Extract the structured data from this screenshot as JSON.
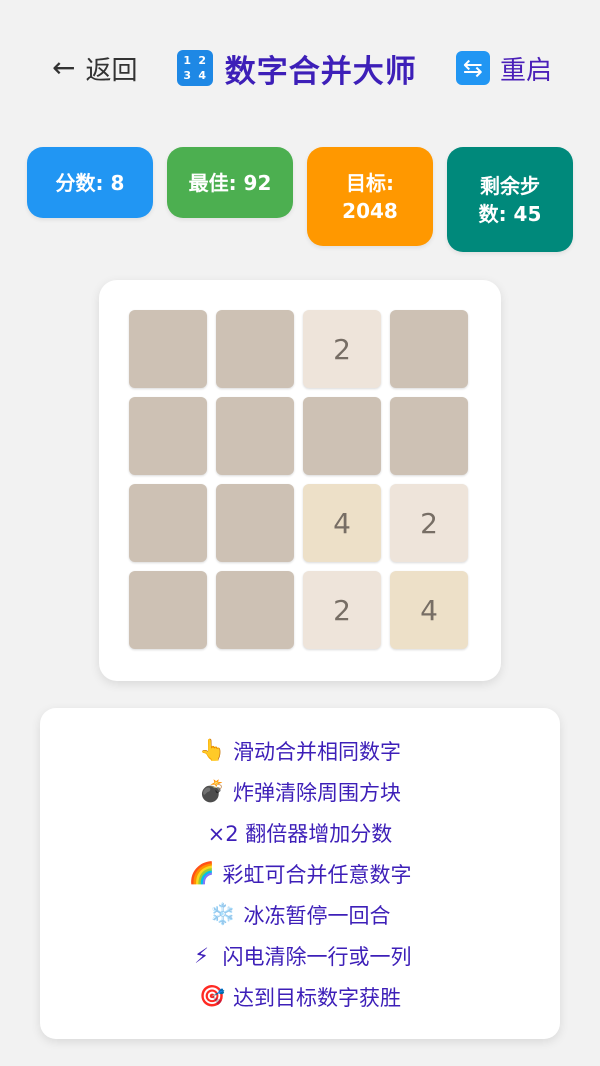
{
  "header": {
    "back_label": "返回",
    "back_icon": "left-arrow-icon",
    "title": "数字合并大师",
    "title_icon": "numbers-icon",
    "title_icon_digits": [
      "1",
      "2",
      "3",
      "4"
    ],
    "restart_label": "重启",
    "restart_icon": "restart-icon"
  },
  "stats": {
    "score": "分数: 8",
    "best": "最佳: 92",
    "target_line1": "目标:",
    "target_line2": "2048",
    "steps_line1": "剩余步",
    "steps_line2": "数: 45"
  },
  "board": {
    "cells": [
      [
        "",
        "",
        "2",
        ""
      ],
      [
        "",
        "",
        "",
        ""
      ],
      [
        "",
        "",
        "4",
        "2"
      ],
      [
        "",
        "",
        "2",
        "4"
      ]
    ]
  },
  "hints": [
    {
      "icon": "👆",
      "icon_name": "pointing-finger-icon",
      "text": "滑动合并相同数字"
    },
    {
      "icon": "💣",
      "icon_name": "bomb-icon",
      "text": "炸弹清除周围方块"
    },
    {
      "icon": "",
      "icon_name": "",
      "text": "×2 翻倍器增加分数"
    },
    {
      "icon": "🌈",
      "icon_name": "rainbow-icon",
      "text": "彩虹可合并任意数字"
    },
    {
      "icon": "❄️",
      "icon_name": "snowflake-icon",
      "text": "冰冻暂停一回合"
    },
    {
      "icon": "⚡",
      "icon_name": "lightning-icon",
      "text": "闪电清除一行或一列"
    },
    {
      "icon": "🎯",
      "icon_name": "target-icon",
      "text": "达到目标数字获胜"
    }
  ],
  "colors": {
    "score": "#2196f3",
    "best": "#4caf50",
    "target": "#ff9800",
    "steps": "#00897b",
    "title": "#3d1fb8"
  }
}
